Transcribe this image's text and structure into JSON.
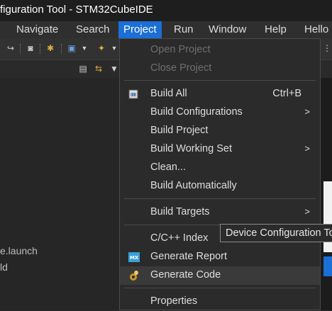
{
  "window": {
    "title": "figuration Tool - STM32CubeIDE"
  },
  "menubar": {
    "items": [
      {
        "label": "Navigate"
      },
      {
        "label": "Search"
      },
      {
        "label": "Project"
      },
      {
        "label": "Run"
      },
      {
        "label": "Window"
      },
      {
        "label": "Help"
      },
      {
        "label": "Hello"
      }
    ],
    "active": "Project"
  },
  "left_panel": {
    "items": [
      "e.launch",
      "ld"
    ]
  },
  "project_menu": {
    "items": [
      {
        "label": "Open Project",
        "enabled": false
      },
      {
        "label": "Close Project",
        "enabled": false
      },
      {
        "label": "Build All",
        "accel": "Ctrl+B",
        "icon": "build-all-icon"
      },
      {
        "label": "Build Configurations",
        "submenu": ">"
      },
      {
        "label": "Build Project"
      },
      {
        "label": "Build Working Set",
        "submenu": ">"
      },
      {
        "label": "Clean..."
      },
      {
        "label": "Build Automatically"
      },
      {
        "label": "Build Targets",
        "submenu": ">"
      },
      {
        "label": "C/C++ Index",
        "submenu": ">"
      },
      {
        "label": "Generate Report",
        "icon": "mx-icon",
        "icon_text": "MX"
      },
      {
        "label": "Generate Code",
        "icon": "gear-wizard-icon"
      },
      {
        "label": "Properties"
      }
    ]
  },
  "tooltip": {
    "text": "Device Configuration Tool"
  },
  "colors": {
    "accent": "#1b6fd6",
    "background": "#2b2b2b",
    "disabled_text": "#6f6f6f"
  }
}
